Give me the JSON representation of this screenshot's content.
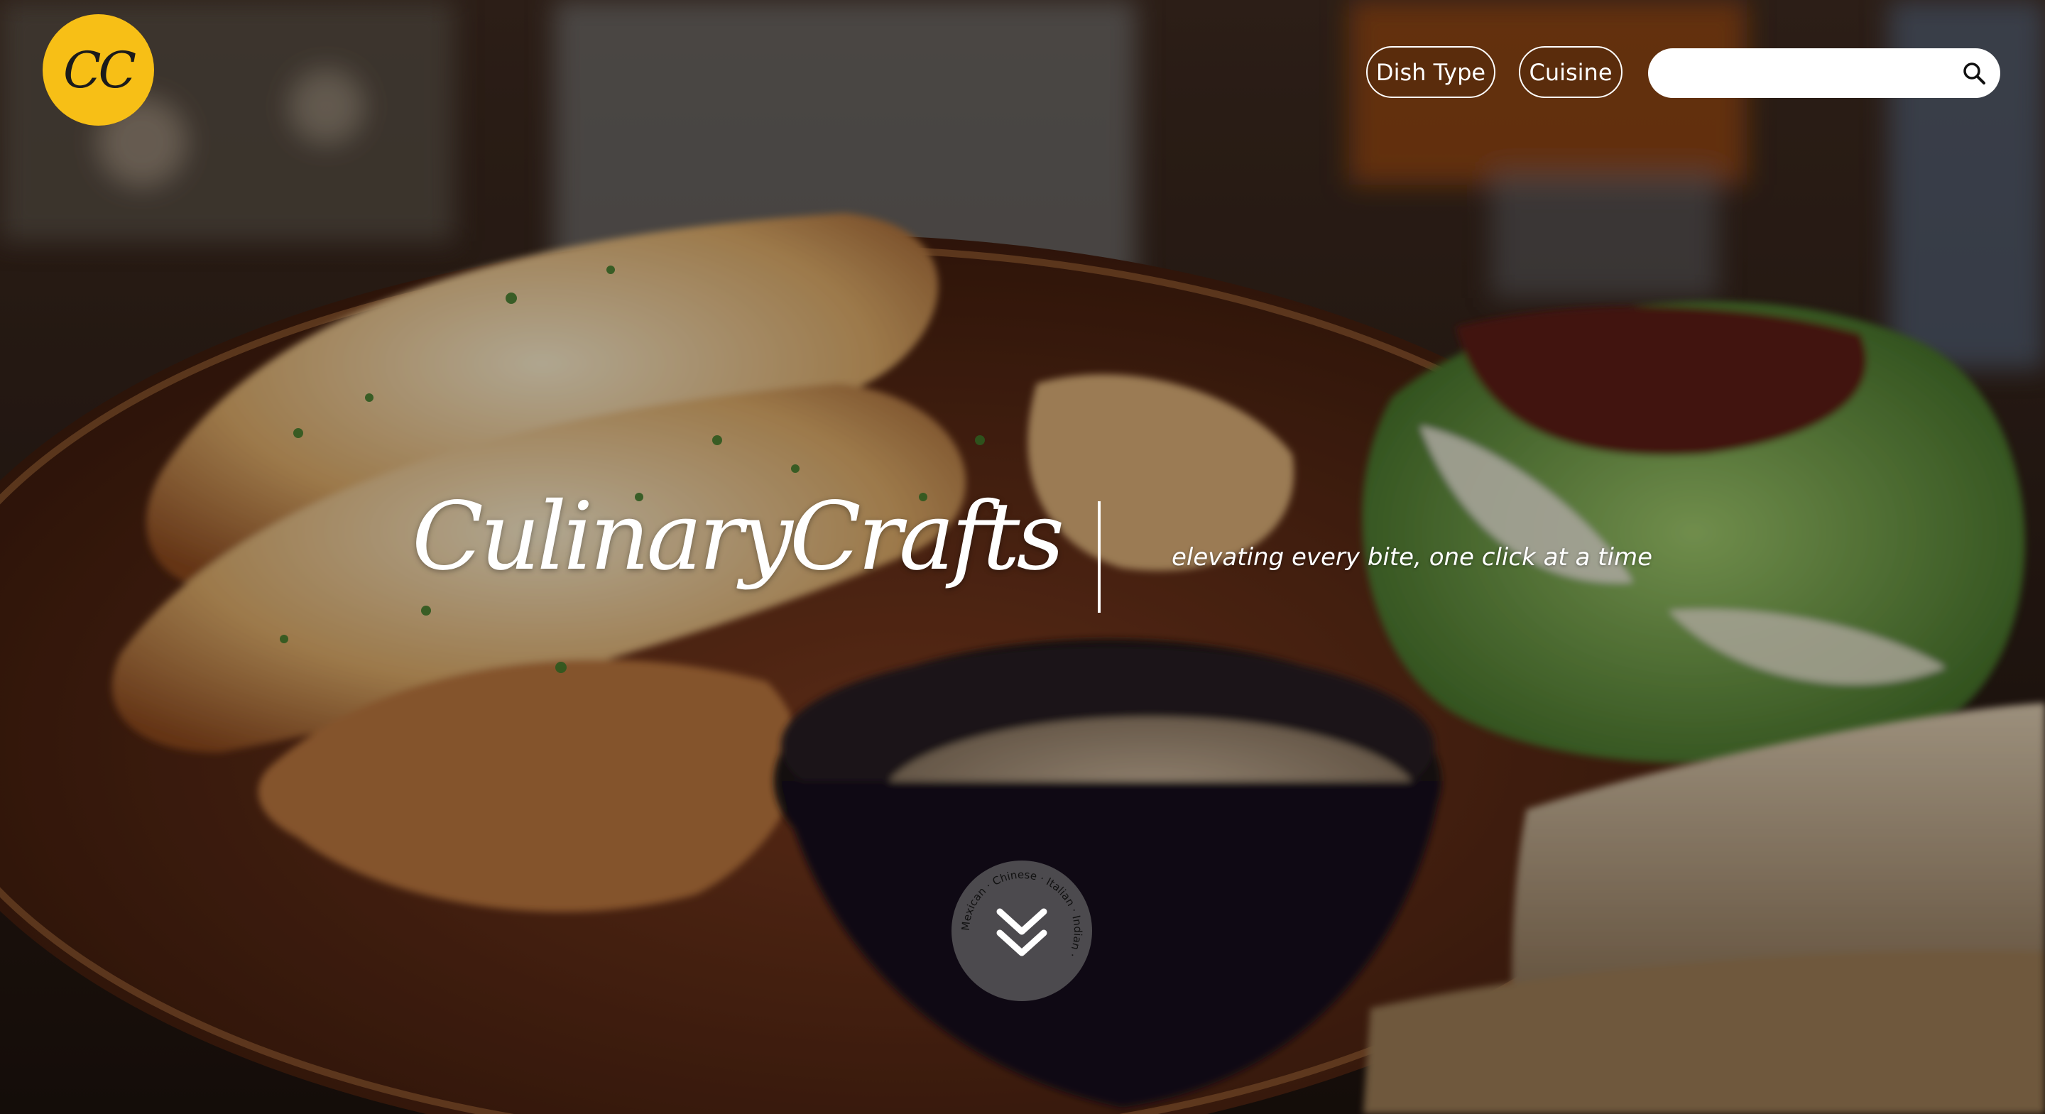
{
  "logo": {
    "text": "CC",
    "color": "#f7bf16"
  },
  "nav": {
    "dish_type_label": "Dish Type",
    "cuisine_label": "Cuisine"
  },
  "search": {
    "placeholder": "",
    "value": "",
    "icon": "search-icon"
  },
  "hero": {
    "title": "CulinaryCrafts",
    "tagline": "elevating every bite, one click at a time"
  },
  "scroll_button": {
    "icon": "double-chevron-down-icon",
    "ring_text": "Mexican  ·  Chinese  ·  Italian  ·  Indian  ·"
  }
}
